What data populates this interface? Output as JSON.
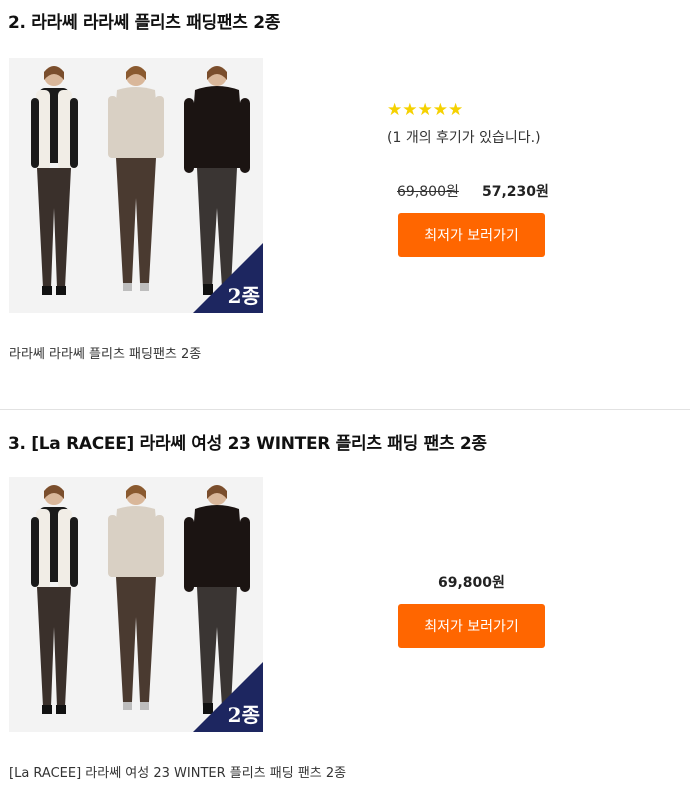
{
  "products": [
    {
      "title": "2. 라라쎄 라라쎄 플리츠 패딩팬츠 2종",
      "badge": "2종",
      "rating": {
        "stars": "★★★★★",
        "value": 5,
        "reviews_text": "(1 개의 후기가 있습니다.)"
      },
      "original_price": "69,800원",
      "price": "57,230원",
      "cta_label": "최저가 보러가기",
      "caption": "라라쎄 라라쎄 플리츠 패딩팬츠 2종"
    },
    {
      "title": "3. [La RACEE] 라라쎄 여성 23 WINTER 플리츠 패딩 팬츠 2종",
      "badge": "2종",
      "price": "69,800원",
      "cta_label": "최저가 보러가기",
      "caption": "[La RACEE] 라라쎄 여성 23 WINTER 플리츠 패딩 팬츠 2종"
    }
  ],
  "colors": {
    "cta": "#ff6600",
    "stars": "#f5d100",
    "badge": "#1d2660",
    "divider": "#e2e2e2"
  }
}
